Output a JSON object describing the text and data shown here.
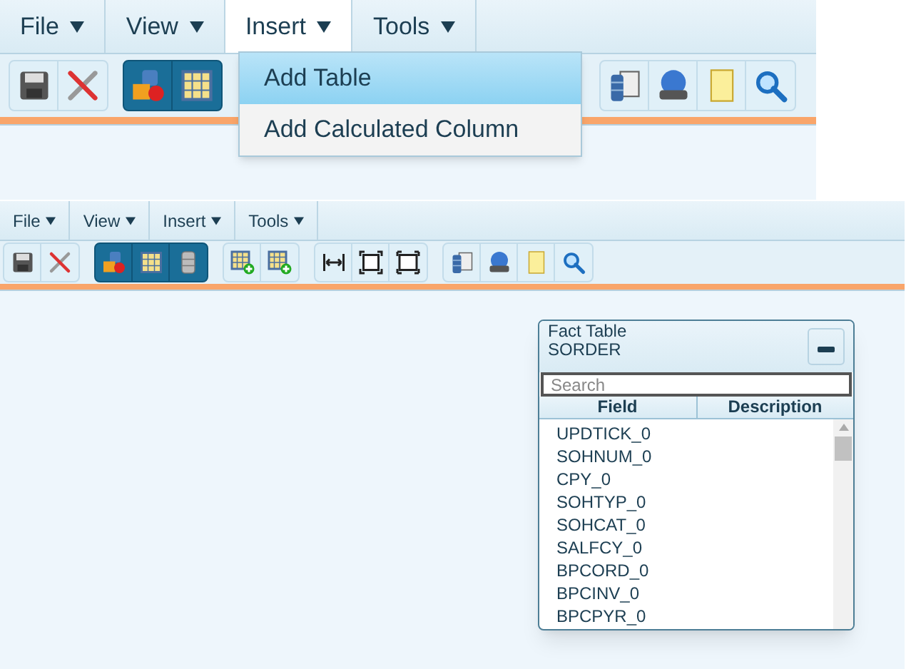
{
  "zoomed_view": {
    "menu": [
      {
        "label": "File",
        "selected": false
      },
      {
        "label": "View",
        "selected": false
      },
      {
        "label": "Insert",
        "selected": true
      },
      {
        "label": "Tools",
        "selected": false
      }
    ],
    "dropdown": [
      {
        "label": "Add Table",
        "selected": true
      },
      {
        "label": "Add Calculated Column",
        "selected": false
      }
    ],
    "toolbar_groups": [
      {
        "selected": false,
        "buttons": [
          {
            "kind": "save"
          },
          {
            "kind": "tools"
          }
        ]
      },
      {
        "selected": true,
        "buttons": [
          {
            "kind": "shapes"
          },
          {
            "kind": "grid"
          }
        ]
      },
      {
        "selected": false,
        "buttons": [
          {
            "kind": "dblist"
          },
          {
            "kind": "globe"
          },
          {
            "kind": "note"
          },
          {
            "kind": "search"
          }
        ]
      }
    ]
  },
  "full_view": {
    "menu": [
      {
        "label": "File",
        "selected": false
      },
      {
        "label": "View",
        "selected": false
      },
      {
        "label": "Insert",
        "selected": false
      },
      {
        "label": "Tools",
        "selected": false
      }
    ],
    "toolbar_groups": [
      {
        "selected": false,
        "buttons": [
          {
            "kind": "save"
          },
          {
            "kind": "tools"
          }
        ]
      },
      {
        "selected": true,
        "buttons": [
          {
            "kind": "shapes"
          },
          {
            "kind": "grid"
          },
          {
            "kind": "column"
          }
        ]
      },
      {
        "selected": false,
        "buttons": [
          {
            "kind": "addgrid"
          },
          {
            "kind": "addgrid"
          }
        ]
      },
      {
        "selected": false,
        "buttons": [
          {
            "kind": "fitwidth"
          },
          {
            "kind": "fitpage"
          },
          {
            "kind": "fitboth"
          }
        ]
      },
      {
        "selected": false,
        "buttons": [
          {
            "kind": "dblist"
          },
          {
            "kind": "globe"
          },
          {
            "kind": "note"
          },
          {
            "kind": "search"
          }
        ]
      }
    ],
    "fact_table": {
      "title": "Fact Table",
      "name": "SORDER",
      "search": {
        "placeholder": "Search"
      },
      "columns": [
        "Field",
        "Description"
      ],
      "rows": [
        "UPDTICK_0",
        "SOHNUM_0",
        "CPY_0",
        "SOHTYP_0",
        "SOHCAT_0",
        "SALFCY_0",
        "BPCORD_0",
        "BPCINV_0",
        "BPCPYR_0"
      ]
    }
  }
}
